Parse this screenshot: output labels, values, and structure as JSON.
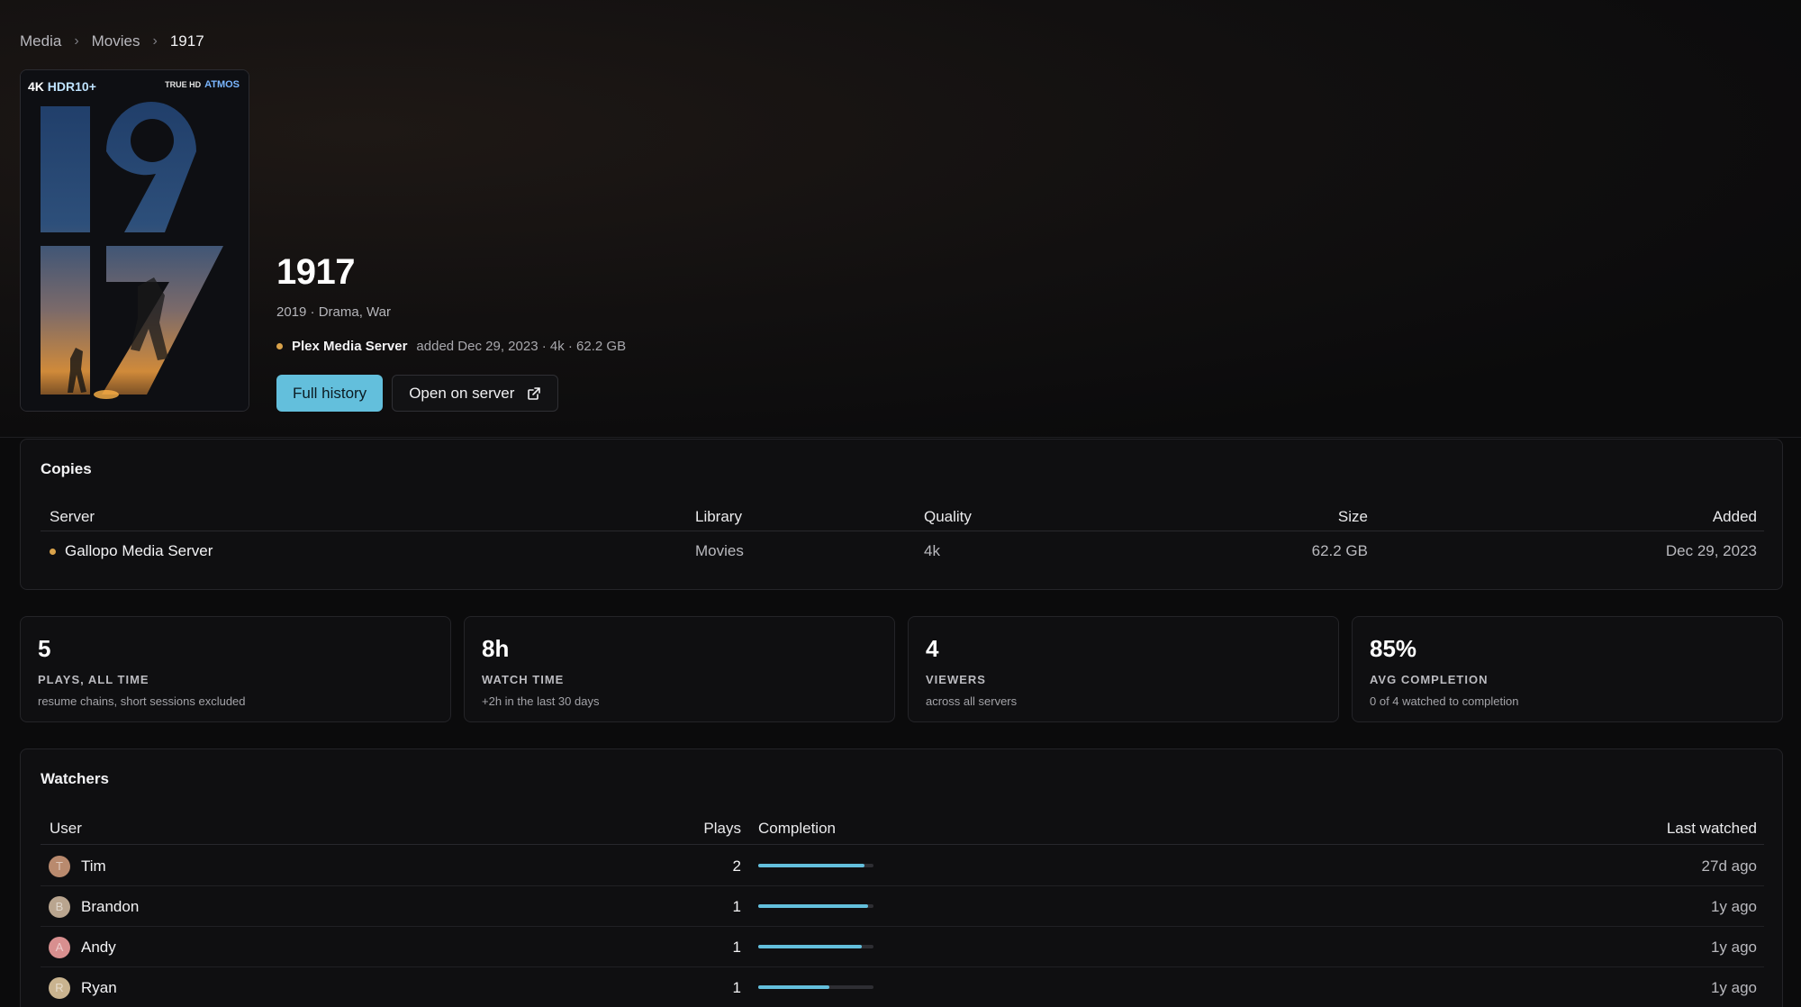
{
  "breadcrumb": [
    "Media",
    "Movies",
    "1917"
  ],
  "poster": {
    "badge_4k": "4K",
    "badge_hdr": "HDR10+",
    "badge_truehd": "TRUE HD",
    "badge_atmos": "ATMOS",
    "poster_title_top": "19",
    "poster_title_bottom": "17"
  },
  "movie": {
    "title": "1917",
    "meta": "2019 · Drama, War",
    "server_name": "Plex Media Server",
    "server_details": "added Dec 29, 2023 · 4k · 62.2 GB"
  },
  "buttons": {
    "full_history": "Full history",
    "open_on_server": "Open on server"
  },
  "copies": {
    "title": "Copies",
    "headers": {
      "server": "Server",
      "library": "Library",
      "quality": "Quality",
      "size": "Size",
      "added": "Added"
    },
    "rows": [
      {
        "server": "Gallopo Media Server",
        "library": "Movies",
        "quality": "4k",
        "size": "62.2 GB",
        "added": "Dec 29, 2023"
      }
    ]
  },
  "stats": [
    {
      "value": "5",
      "label": "PLAYS, ALL TIME",
      "sub": "resume chains, short sessions excluded"
    },
    {
      "value": "8h",
      "label": "WATCH TIME",
      "sub": "+2h in the last 30 days"
    },
    {
      "value": "4",
      "label": "VIEWERS",
      "sub": "across all servers"
    },
    {
      "value": "85%",
      "label": "AVG COMPLETION",
      "sub": "0 of 4 watched to completion"
    }
  ],
  "watchers": {
    "title": "Watchers",
    "headers": {
      "user": "User",
      "plays": "Plays",
      "completion": "Completion",
      "last_watched": "Last watched"
    },
    "rows": [
      {
        "initial": "T",
        "user": "Tim",
        "plays": "2",
        "completion": 0.92,
        "last_watched": "27d ago",
        "avatar_color": "#b98a6e"
      },
      {
        "initial": "B",
        "user": "Brandon",
        "plays": "1",
        "completion": 0.95,
        "last_watched": "1y ago",
        "avatar_color": "#b9a58f"
      },
      {
        "initial": "A",
        "user": "Andy",
        "plays": "1",
        "completion": 0.9,
        "last_watched": "1y ago",
        "avatar_color": "#d88f8f"
      },
      {
        "initial": "R",
        "user": "Ryan",
        "plays": "1",
        "completion": 0.62,
        "last_watched": "1y ago",
        "avatar_color": "#c9b38f"
      }
    ]
  },
  "colors": {
    "accent": "#63bfdc",
    "server_dot": "#d9a24a",
    "background": "#0b0b0c"
  }
}
